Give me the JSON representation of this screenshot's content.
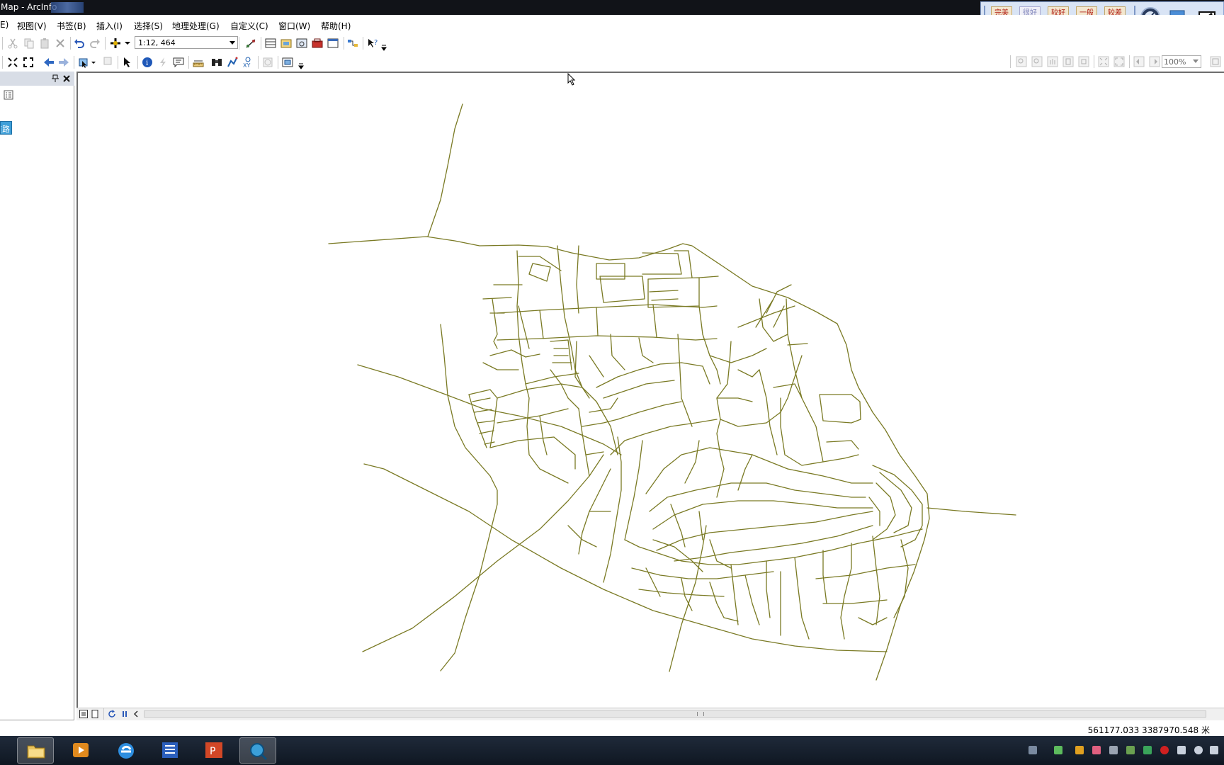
{
  "window": {
    "title": "Map - ArcInfo"
  },
  "menu": [
    {
      "label": "E)"
    },
    {
      "label": "视图(V)"
    },
    {
      "label": "书签(B)"
    },
    {
      "label": "插入(I)"
    },
    {
      "label": "选择(S)"
    },
    {
      "label": "地理处理(G)"
    },
    {
      "label": "自定义(C)"
    },
    {
      "label": "窗口(W)"
    },
    {
      "label": "帮助(H)"
    }
  ],
  "toolbar": {
    "scale_value": "1:12, 464"
  },
  "quality_bar": {
    "buttons": [
      {
        "label": "完美画质"
      },
      {
        "label": "很好画质"
      },
      {
        "label": "较好画质"
      },
      {
        "label": "一般画质"
      },
      {
        "label": "较差画质"
      }
    ]
  },
  "layout_toolbar": {
    "zoom_value": "100%"
  },
  "toc": {
    "layer_label": "道路"
  },
  "status": {
    "coordinates": "561177.033  3387970.548 米"
  },
  "colors": {
    "road_line": "#7a7a24",
    "title_bar": "#111318",
    "taskbar": "#1a2433",
    "toc_selection": "#3f9fd8"
  }
}
